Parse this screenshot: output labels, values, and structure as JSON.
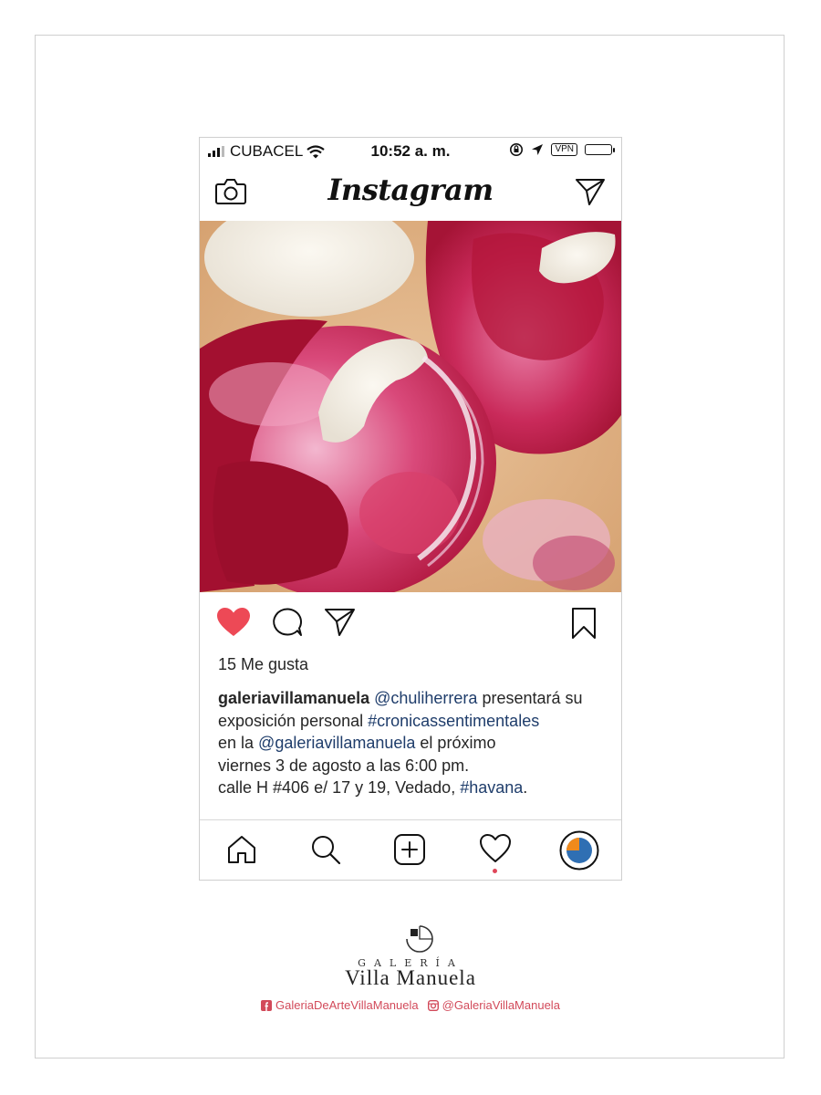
{
  "status_bar": {
    "carrier": "CUBACEL",
    "time": "10:52 a. m.",
    "vpn": "VPN"
  },
  "header": {
    "logo": "Instagram",
    "camera_icon": "camera-icon",
    "direct_icon": "paper-plane-icon"
  },
  "post": {
    "image_icon": "abstract-painting",
    "liked": true,
    "like_color": "#ed4956",
    "likes": "15 Me gusta",
    "caption": {
      "username": "galeriavillamanuela",
      "mention_1": "@chuliherrera",
      "text_1": " presentará su exposición personal ",
      "hashtag_1": "#cronicassentimentales",
      "text_2": "en la ",
      "mention_2": "@galeriavillamanuela",
      "text_3": " el próximo",
      "line_4": "viernes 3 de agosto a las 6:00 pm.",
      "text_5": "calle H #406 e/ 17 y 19, Vedado, ",
      "hashtag_2": "#havana",
      "text_6": "."
    },
    "link_color": "#1f3d6b"
  },
  "bottom_nav": {
    "items": [
      "home-icon",
      "search-icon",
      "add-post-icon",
      "activity-heart-icon",
      "profile-avatar"
    ],
    "activity_dot_color": "#e0475a"
  },
  "brand": {
    "galeria": "GALERÍA",
    "name": "Villa Manuela",
    "facebook": "GaleriaDeArteVillaManuela",
    "instagram": "@GaleriaVillaManuela",
    "accent": "#d24a5a"
  }
}
